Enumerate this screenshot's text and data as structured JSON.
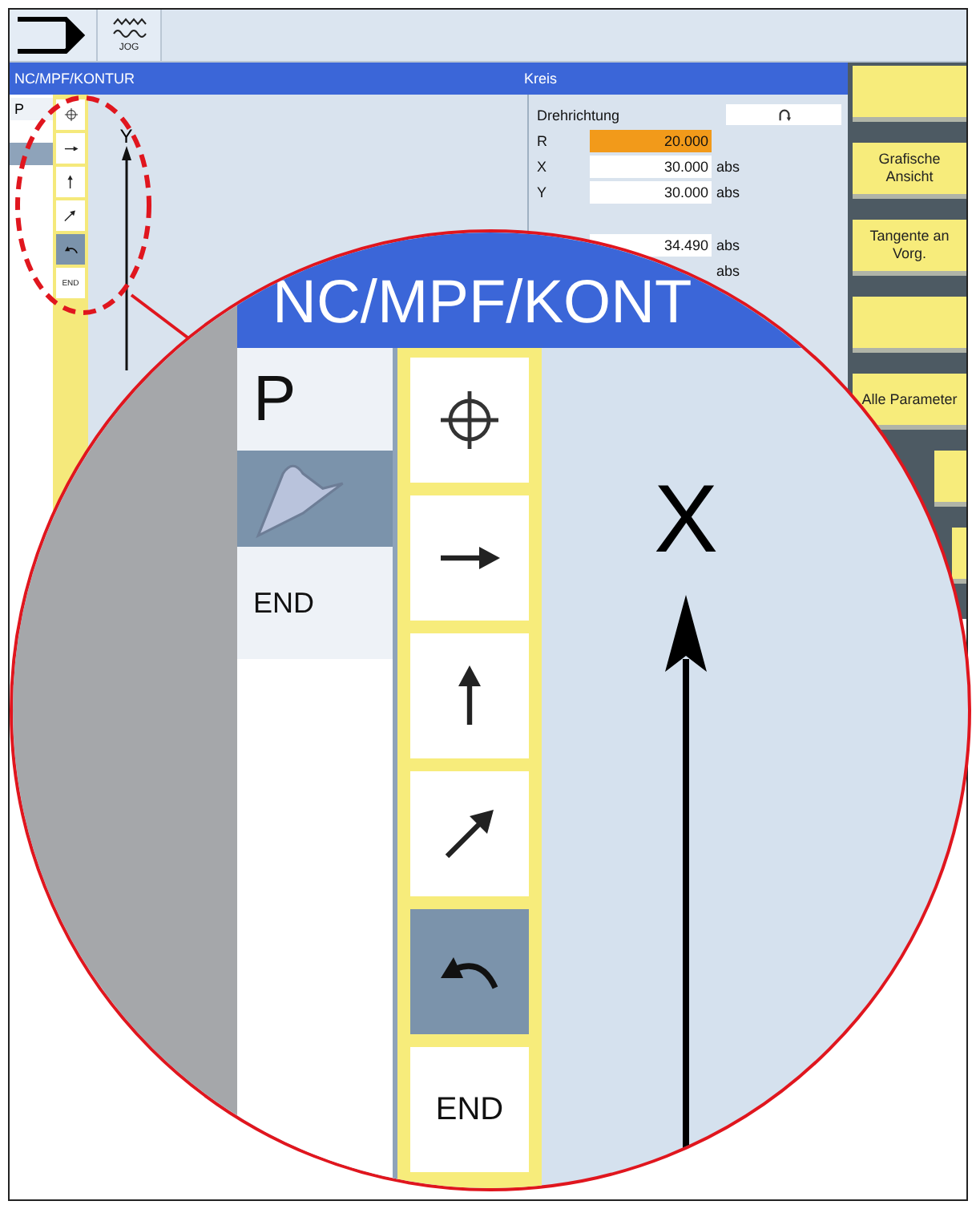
{
  "top_bar": {
    "mode_label": "JOG"
  },
  "screen": {
    "header": {
      "path": "NC/MPF/KONTUR",
      "panel_title": "Kreis"
    },
    "contour_list": [
      {
        "kind": "text",
        "label": "P",
        "selected": false
      },
      {
        "kind": "contour",
        "selected": true
      }
    ],
    "element_toolbar": [
      {
        "kind": "crosshair",
        "selected": false
      },
      {
        "kind": "arrow-right",
        "selected": false
      },
      {
        "kind": "arrow-up",
        "selected": false
      },
      {
        "kind": "arrow-diagonal",
        "selected": false
      },
      {
        "kind": "arc",
        "selected": true
      },
      {
        "kind": "end",
        "label": "END",
        "selected": false
      }
    ],
    "axis_label": "Y",
    "parameters": {
      "direction_label": "Drehrichtung",
      "rows": [
        {
          "label": "R",
          "value": "20.000",
          "highlighted": true
        },
        {
          "label": "X",
          "value": "30.000",
          "unit": "abs",
          "highlighted": false
        },
        {
          "label": "Y",
          "value": "30.000",
          "unit": "abs",
          "highlighted": false
        }
      ],
      "extra_rows": [
        {
          "value": "34.490",
          "unit": "abs"
        },
        {
          "unit": "abs"
        }
      ]
    }
  },
  "softkeys": [
    {
      "kind": "blank"
    },
    {
      "kind": "labeled",
      "label": "Grafische Ansicht"
    },
    {
      "kind": "labeled",
      "label": "Tangente an Vorg."
    },
    {
      "kind": "blank"
    },
    {
      "kind": "labeled",
      "label": "Alle Parameter"
    },
    {
      "kind": "blank"
    },
    {
      "kind": "blank"
    }
  ],
  "magnifier": {
    "header": "NC/MPF/KONT",
    "contour_list": [
      {
        "kind": "text",
        "label": "P",
        "selected": false
      },
      {
        "kind": "contour",
        "selected": true
      },
      {
        "kind": "text",
        "label": "END",
        "selected": false
      }
    ],
    "element_toolbar": [
      {
        "kind": "crosshair",
        "selected": false
      },
      {
        "kind": "arrow-right",
        "selected": false
      },
      {
        "kind": "arrow-up",
        "selected": false
      },
      {
        "kind": "arrow-diagonal",
        "selected": false
      },
      {
        "kind": "arc",
        "selected": true
      },
      {
        "kind": "end",
        "label": "END",
        "selected": false
      }
    ],
    "axis_label": "X"
  }
}
